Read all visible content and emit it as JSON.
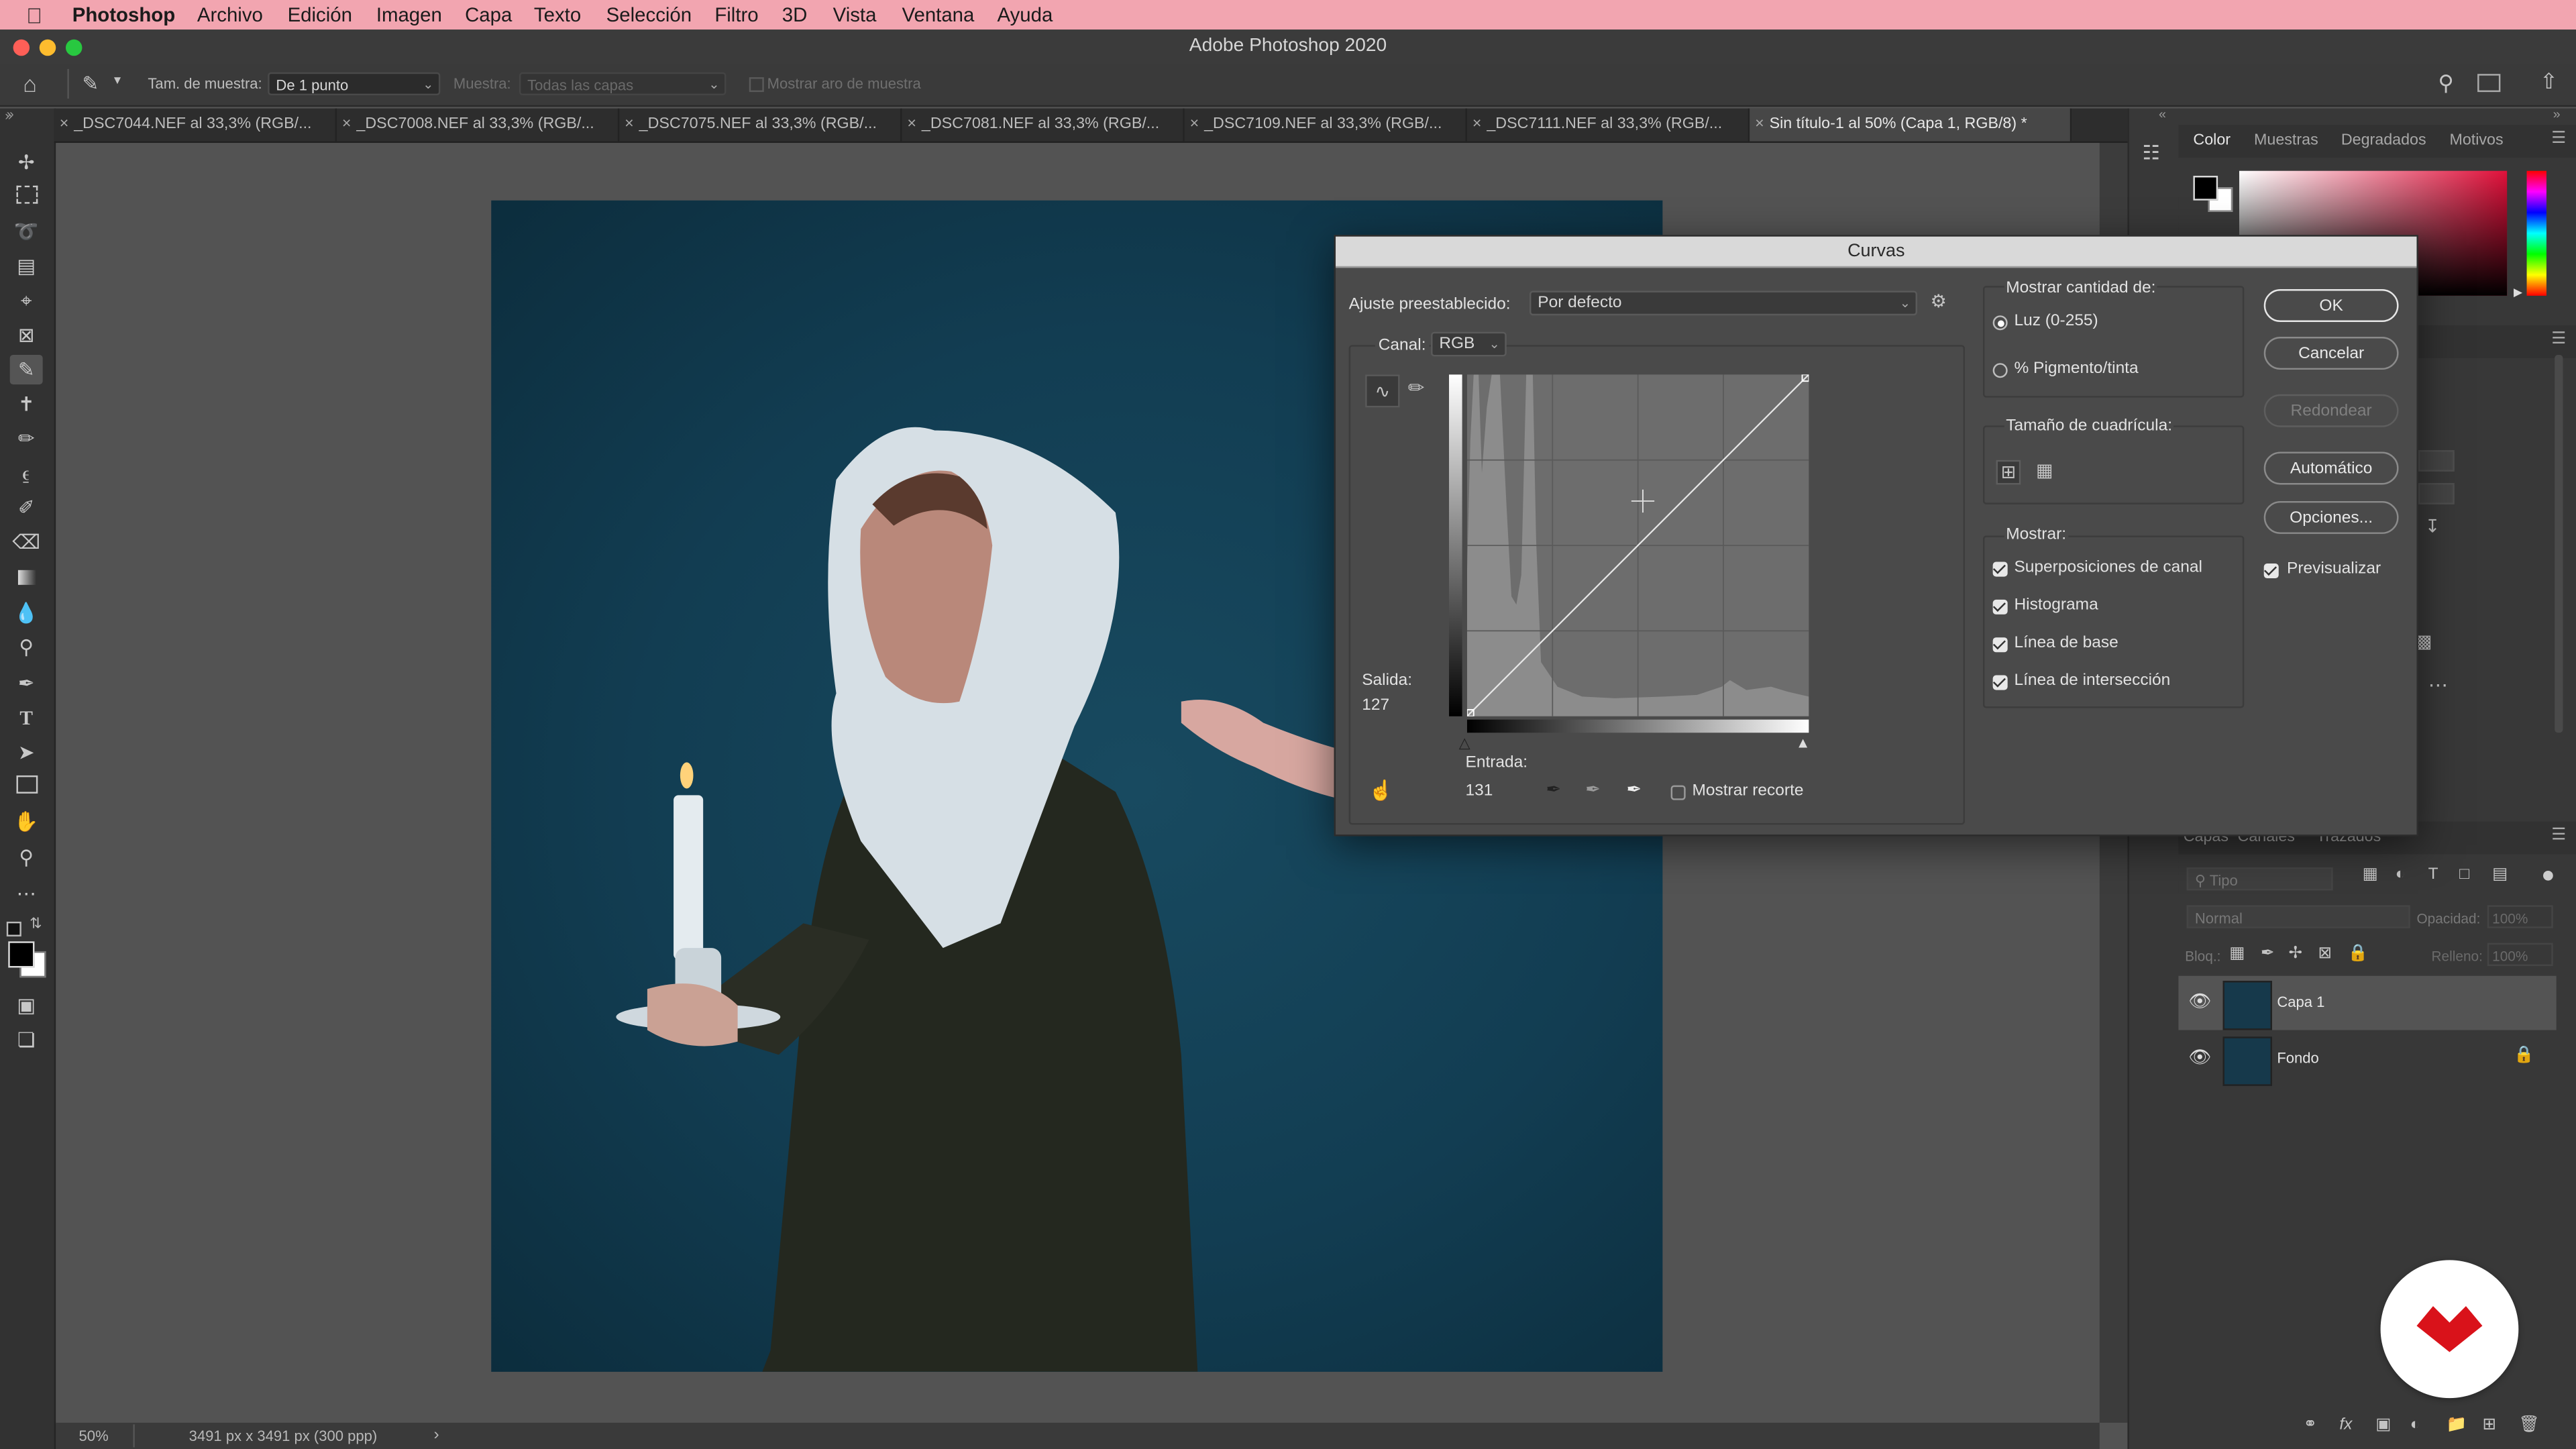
{
  "menubar": {
    "items": [
      "Photoshop",
      "Archivo",
      "Edición",
      "Imagen",
      "Capa",
      "Texto",
      "Selección",
      "Filtro",
      "3D",
      "Vista",
      "Ventana",
      "Ayuda"
    ]
  },
  "window": {
    "title": "Adobe Photoshop 2020"
  },
  "options": {
    "sample_size_label": "Tam. de muestra:",
    "sample_size_value": "De 1 punto",
    "sample_label": "Muestra:",
    "sample_value": "Todas las capas",
    "show_ring_label": "Mostrar aro de muestra"
  },
  "tabs": [
    "_DSC7044.NEF al 33,3% (RGB/...",
    "_DSC7008.NEF al 33,3% (RGB/...",
    "_DSC7075.NEF al 33,3% (RGB/...",
    "_DSC7081.NEF al 33,3% (RGB/...",
    "_DSC7109.NEF al 33,3% (RGB/...",
    "_DSC7111.NEF al 33,3% (RGB/...",
    "Sin título-1 al 50% (Capa 1, RGB/8) *"
  ],
  "status": {
    "zoom": "50%",
    "doc_size": "3491 px x 3491 px (300 ppp)"
  },
  "curves": {
    "title": "Curvas",
    "preset_label": "Ajuste preestablecido:",
    "preset_value": "Por defecto",
    "channel_label": "Canal:",
    "channel_value": "RGB",
    "output_label": "Salida:",
    "output_value": "127",
    "input_label": "Entrada:",
    "input_value": "131",
    "show_clipping": "Mostrar recorte",
    "show_amount_label": "Mostrar cantidad de:",
    "light_option": "Luz (0-255)",
    "pigment_option": "% Pigmento/tinta",
    "grid_size_label": "Tamaño de cuadrícula:",
    "show_label": "Mostrar:",
    "show_options": [
      "Superposiciones de canal",
      "Histograma",
      "Línea de base",
      "Línea de intersección"
    ],
    "buttons": {
      "ok": "OK",
      "cancel": "Cancelar",
      "smooth": "Redondear",
      "auto": "Automático",
      "options": "Opciones..."
    },
    "preview_label": "Previsualizar"
  },
  "color_panel": {
    "tabs": [
      "Color",
      "Muestras",
      "Degradados",
      "Motivos"
    ]
  },
  "layers_panel": {
    "tabs": [
      "Capas",
      "Canales",
      "Trazados"
    ],
    "search_placeholder": "Tipo",
    "blend_mode": "Normal",
    "opacity_label": "Opacidad:",
    "opacity_value": "100%",
    "lock_label": "Bloq.:",
    "fill_label": "Relleno:",
    "fill_value": "100%",
    "layers": [
      {
        "name": "Capa 1"
      },
      {
        "name": "Fondo"
      }
    ]
  }
}
